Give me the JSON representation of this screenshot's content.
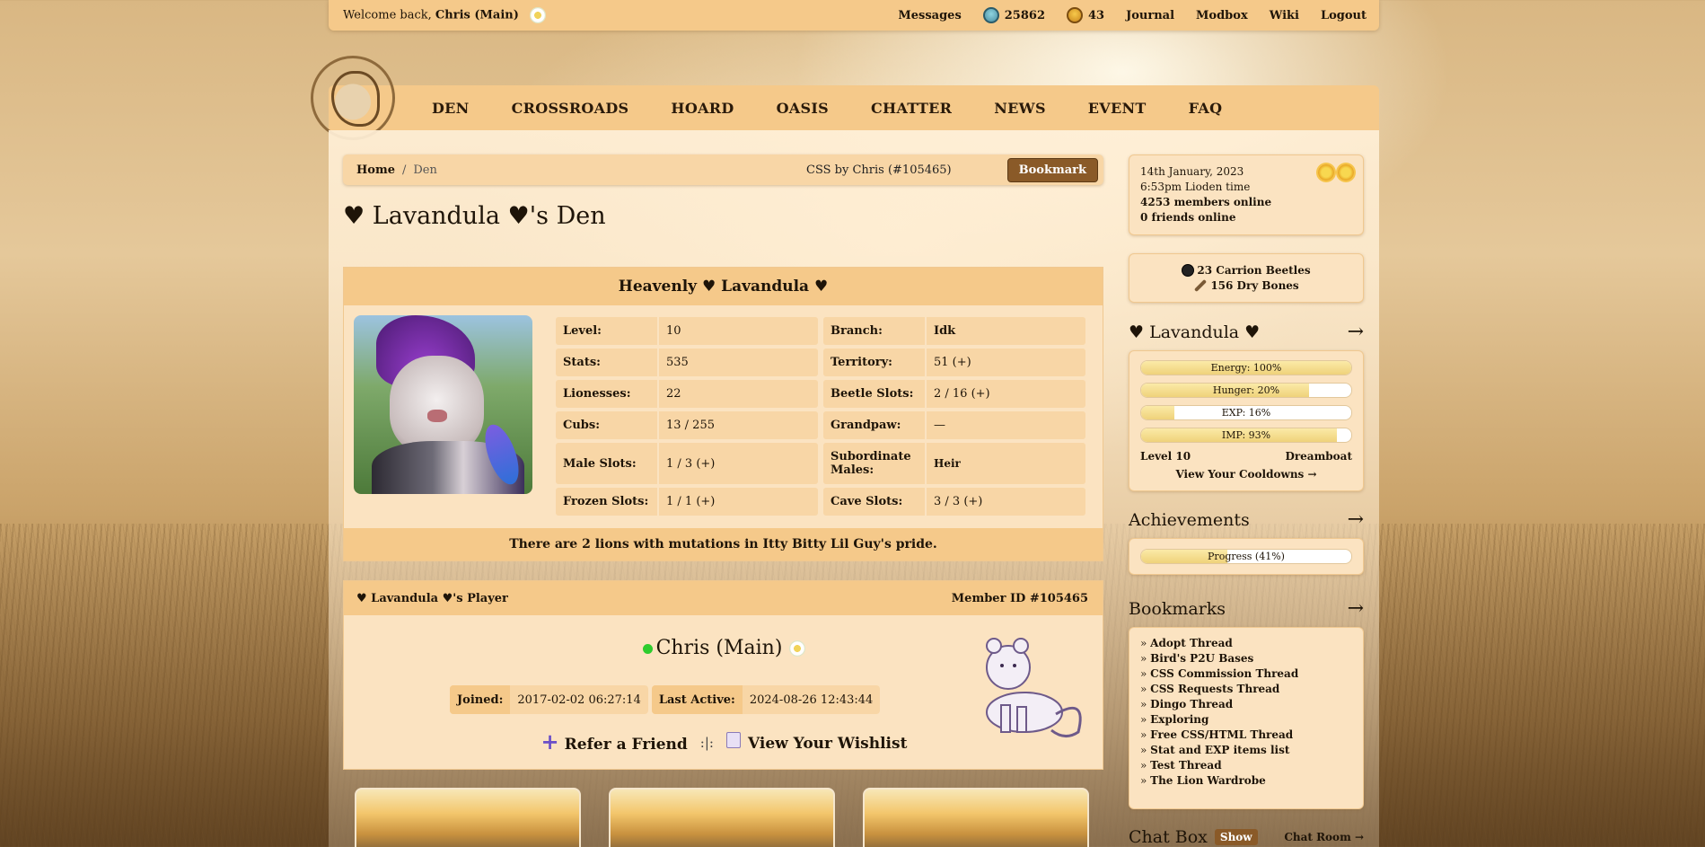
{
  "topbar": {
    "welcome_prefix": "Welcome back,",
    "username": "Chris (Main)",
    "nav": {
      "messages": "Messages",
      "silver_beetles": "25862",
      "gold_beetles": "43",
      "journal": "Journal",
      "modbox": "Modbox",
      "wiki": "Wiki",
      "logout": "Logout"
    }
  },
  "mainnav": [
    "DEN",
    "CROSSROADS",
    "HOARD",
    "OASIS",
    "CHATTER",
    "NEWS",
    "EVENT",
    "FAQ"
  ],
  "breadcrumb": {
    "home": "Home",
    "sep": "/",
    "current": "Den"
  },
  "css_credit": "CSS by Chris (#105465)",
  "bookmark_button": "Bookmark",
  "den_title": "♥ Lavandula ♥'s Den",
  "lion": {
    "name": "Heavenly ♥ Lavandula ♥",
    "stats_left": [
      {
        "k": "Level:",
        "v": "10"
      },
      {
        "k": "Stats:",
        "v": "535"
      },
      {
        "k": "Lionesses:",
        "v": "22"
      },
      {
        "k": "Cubs:",
        "v": "13 / 255"
      },
      {
        "k": "Male Slots:",
        "v": "1 / 3 (+)"
      },
      {
        "k": "Frozen Slots:",
        "v": "1 / 1 (+)"
      }
    ],
    "stats_right": [
      {
        "k": "Branch:",
        "v": "Idk"
      },
      {
        "k": "Territory:",
        "v": "51 (+)"
      },
      {
        "k": "Beetle Slots:",
        "v": "2 / 16 (+)"
      },
      {
        "k": "Grandpaw:",
        "v": "—"
      },
      {
        "k": "Subordinate Males:",
        "v": "Heir"
      },
      {
        "k": "Cave Slots:",
        "v": "3 / 3 (+)"
      }
    ],
    "mutations_note": "There are 2 lions with mutations in Itty Bitty Lil Guy's pride."
  },
  "player": {
    "header": "♥ Lavandula ♥'s Player",
    "member_id": "Member ID #105465",
    "name": "Chris (Main)",
    "joined_label": "Joined:",
    "joined": "2017-02-02 06:27:14",
    "active_label": "Last Active:",
    "active": "2024-08-26 12:43:44",
    "refer": "Refer a Friend",
    "sep": ":|:",
    "wishlist": "View Your Wishlist"
  },
  "sidebar": {
    "date": "14th January, 2023",
    "time": "6:53pm Lioden time",
    "members_online": "4253 members online",
    "friends_online": "0 friends online",
    "carrion": "23 Carrion Beetles",
    "bones": "156 Dry Bones",
    "lion_title": "♥ Lavandula ♥",
    "arrow": "→",
    "bars": [
      {
        "label": "Energy: 100%",
        "value": 100
      },
      {
        "label": "Hunger: 20%",
        "value": 80
      },
      {
        "label": "EXP: 16%",
        "value": 16
      },
      {
        "label": "IMP: 93%",
        "value": 93
      }
    ],
    "level": "Level 10",
    "title": "Dreamboat",
    "cooldowns": "View Your Cooldowns →",
    "achievements_title": "Achievements",
    "progress_label": "Progress (41%)",
    "progress_value": 41,
    "bookmarks_title": "Bookmarks",
    "bookmarks": [
      "Adopt Thread",
      "Bird's P2U Bases",
      "CSS Commission Thread",
      "CSS Requests Thread",
      "Dingo Thread",
      "Exploring",
      "Free CSS/HTML Thread",
      "Stat and EXP items list",
      "Test Thread",
      "The Lion Wardrobe"
    ],
    "chat_title": "Chat Box",
    "chat_show": "Show",
    "chat_room": "Chat Room →"
  }
}
